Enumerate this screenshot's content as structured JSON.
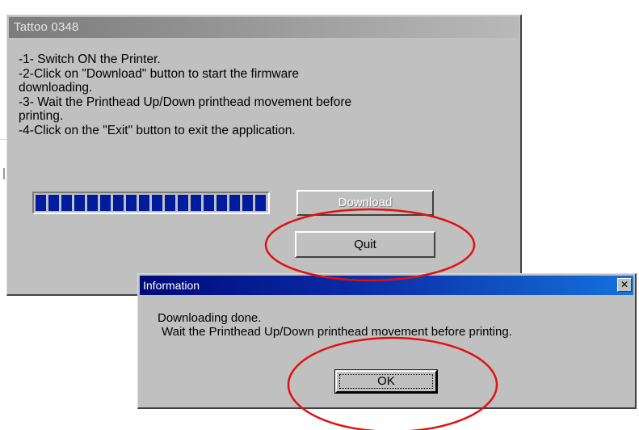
{
  "main_window": {
    "title": "Tattoo 0348",
    "instructions": [
      "-1- Switch ON the Printer.",
      "-2-Click on \"Download\" button to start the firmware",
      "downloading.",
      "-3- Wait the Printhead Up/Down printhead movement before",
      "printing.",
      "-4-Click on the \"Exit\" button to exit the application."
    ],
    "progress": {
      "value": 1.0
    },
    "download_label": "Download",
    "quit_label": "Quit"
  },
  "info_dialog": {
    "title": "Information",
    "close_icon": "close-icon",
    "message_line1": "Downloading done.",
    "message_line2": "Wait the Printhead Up/Down printhead movement before printing.",
    "ok_label": "OK"
  },
  "colors": {
    "progress_block": "#001c9e",
    "annotation": "#e01010",
    "info_titlebar": "#0a2ca8"
  }
}
